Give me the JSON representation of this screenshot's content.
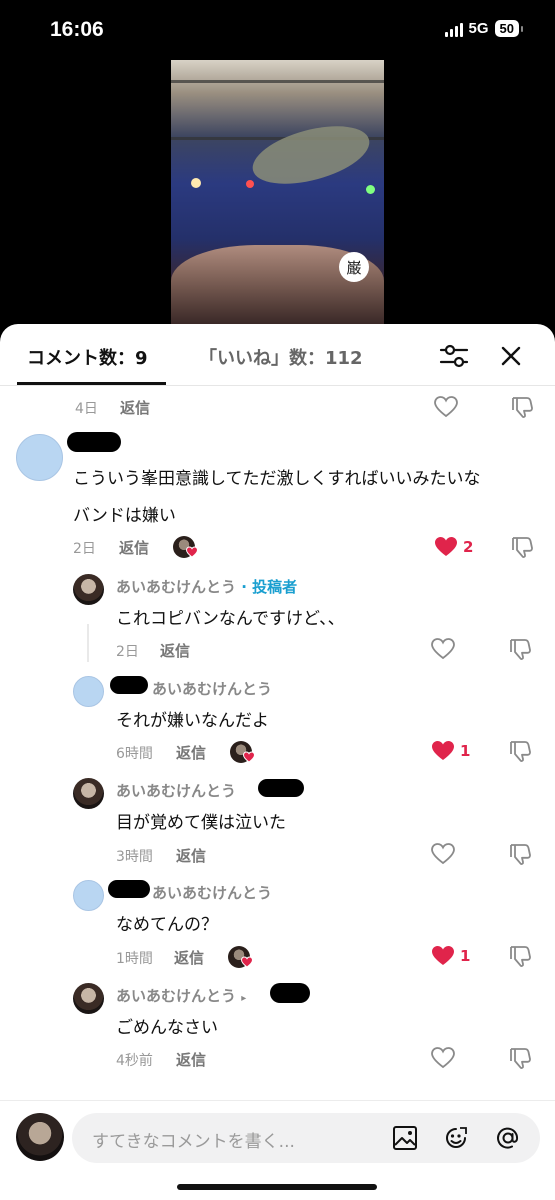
{
  "status_bar": {
    "time": "16:06",
    "network": "5G",
    "battery": "50"
  },
  "video": {
    "badge_text": "巌"
  },
  "tabs": {
    "comments": "コメント数：9",
    "likes": "「いいね」数：112"
  },
  "comments": [
    {
      "time": "4日",
      "reply": "返信"
    },
    {
      "text_line1": "こういう峯田意識してただ激しくすればいいみたいな",
      "text_line2": "バンドは嫌い",
      "time": "2日",
      "reply": "返信",
      "likes": "2"
    },
    {
      "name": "あいあむけんとう",
      "tag": "· 投稿者",
      "text": "これコピバンなんですけど、、",
      "time": "2日",
      "reply": "返信"
    },
    {
      "name": "あいあむけんとう",
      "text": "それが嫌いなんだよ",
      "time": "6時間",
      "reply": "返信",
      "likes": "1"
    },
    {
      "name": "あいあむけんとう",
      "text": "目が覚めて僕は泣いた",
      "time": "3時間",
      "reply": "返信"
    },
    {
      "name": "あいあむけんとう",
      "text": "なめてんの？",
      "time": "1時間",
      "reply": "返信",
      "likes": "1"
    },
    {
      "name": "あいあむけんとう",
      "text": "ごめんなさい",
      "time": "4秒前",
      "reply": "返信"
    }
  ],
  "input": {
    "placeholder": "すてきなコメントを書く..."
  },
  "icons": [
    "filter-icon",
    "close-icon",
    "heart-icon",
    "dislike-icon",
    "image-icon",
    "emoji-icon",
    "mention-icon"
  ],
  "colors": {
    "like_red": "#e0244b",
    "author_tag": "#1a9fd0",
    "avatar_blue": "#b9d6f2"
  }
}
